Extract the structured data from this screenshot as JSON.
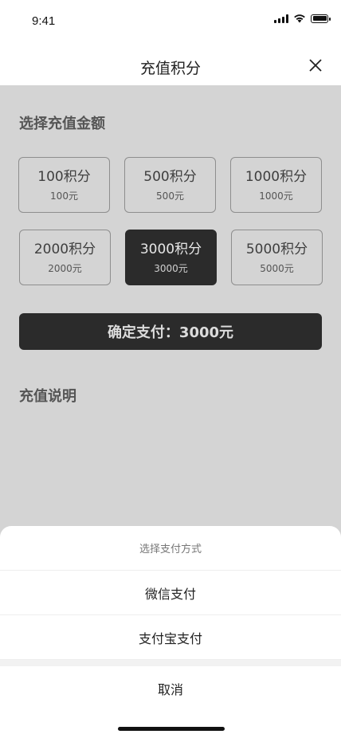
{
  "status_bar": {
    "time": "9:41"
  },
  "header": {
    "title": "充值积分"
  },
  "amount_section": {
    "title": "选择充值金额"
  },
  "options": [
    {
      "points": "100积分",
      "price": "100元",
      "selected": false
    },
    {
      "points": "500积分",
      "price": "500元",
      "selected": false
    },
    {
      "points": "1000积分",
      "price": "1000元",
      "selected": false
    },
    {
      "points": "2000积分",
      "price": "2000元",
      "selected": false
    },
    {
      "points": "3000积分",
      "price": "3000元",
      "selected": true
    },
    {
      "points": "5000积分",
      "price": "5000元",
      "selected": false
    }
  ],
  "pay_button": {
    "label": "确定支付：3000元"
  },
  "description_section": {
    "title": "充值说明"
  },
  "payment_sheet": {
    "title": "选择支付方式",
    "methods": [
      "微信支付",
      "支付宝支付"
    ],
    "cancel_label": "取消"
  },
  "colors": {
    "selected_bg": "#2b2b2b",
    "overlay": "#d4d4d4"
  }
}
